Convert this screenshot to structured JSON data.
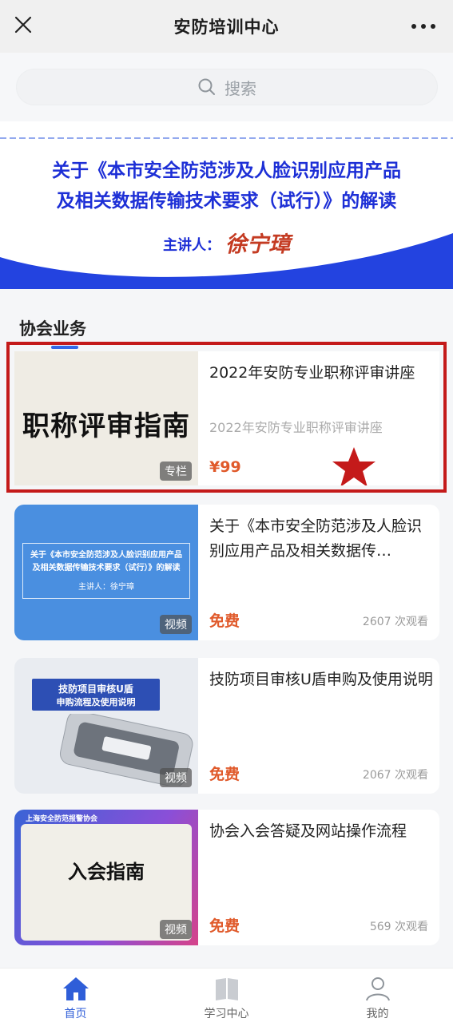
{
  "header": {
    "title": "安防培训中心"
  },
  "search": {
    "placeholder": "搜索"
  },
  "banner": {
    "line1": "关于《本市安全防范涉及人脸识别应用产品",
    "line2": "及相关数据传输技术要求（试行）》的解读",
    "speaker_label": "主讲人：",
    "speaker_name": "徐宁璋"
  },
  "section": {
    "title": "协会业务"
  },
  "courses": [
    {
      "thumb_text": "职称评审指南",
      "tag": "专栏",
      "name": "2022年安防专业职称评审讲座",
      "subtitle": "2022年安防专业职称评审讲座",
      "price": "¥99",
      "views": ""
    },
    {
      "thumb_line1": "关于《本市安全防范涉及人脸识别应用产品",
      "thumb_line2": "及相关数据传输技术要求（试行）》的解读",
      "thumb_speaker": "主讲人：徐宁璋",
      "tag": "视频",
      "name": "关于《本市安全防范涉及人脸识别应用产品及相关数据传…",
      "price": "免费",
      "views": "2607 次观看"
    },
    {
      "thumb_line1": "技防项目审核U盾",
      "thumb_line2": "申购流程及使用说明",
      "tag": "视频",
      "name": "技防项目审核U盾申购及使用说明",
      "price": "免费",
      "views": "2067 次观看"
    },
    {
      "thumb_header": "上海安全防范报警协会",
      "thumb_text": "入会指南",
      "tag": "视频",
      "name": "协会入会答疑及网站操作流程",
      "price": "免费",
      "views": "569 次观看"
    }
  ],
  "nav": {
    "items": [
      {
        "label": "首页",
        "icon": "home-icon"
      },
      {
        "label": "学习中心",
        "icon": "book-icon"
      },
      {
        "label": "我的",
        "icon": "user-icon"
      }
    ]
  },
  "colors": {
    "accent": "#2f5ed8",
    "price": "#e05a2b",
    "banner_blue": "#1d2fd6",
    "highlight_red": "#c41a1a"
  }
}
